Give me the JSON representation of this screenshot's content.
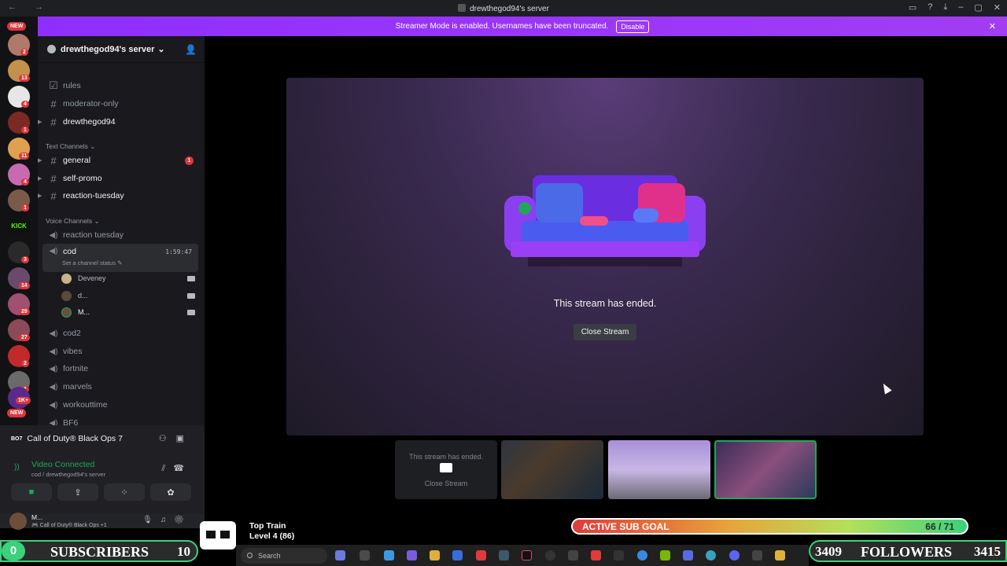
{
  "window": {
    "title": "drewthegod94's server",
    "nav_glyphs": "← →",
    "controls": [
      "▭",
      "?",
      "⤓",
      "–",
      "▢",
      "✕"
    ]
  },
  "banner": {
    "text": "Streamer Mode is enabled. Usernames have been truncated.",
    "disable_label": "Disable",
    "close_glyph": "✕"
  },
  "rail": {
    "new_top": "NEW",
    "new_bottom": "NEW",
    "badges": [
      "2",
      "13",
      "4",
      "1",
      "11",
      "4",
      "1",
      "3",
      "14",
      "29",
      "27",
      "2",
      "1",
      "1K+"
    ]
  },
  "server": {
    "name": "drewthegod94's server",
    "chevron": "⌄",
    "invite_glyph": "👤"
  },
  "channels_top": [
    {
      "name": "rules",
      "glyph": "☑"
    },
    {
      "name": "moderator-only",
      "glyph": "#"
    },
    {
      "name": "drewthegod94",
      "glyph": "#"
    }
  ],
  "text_category": "Text Channels",
  "text_channels": [
    {
      "name": "general",
      "unread": "1"
    },
    {
      "name": "self-promo"
    },
    {
      "name": "reaction-tuesday"
    }
  ],
  "voice_category": "Voice Channels",
  "voice_channels": {
    "reaction": "reaction tuesday",
    "active": {
      "name": "cod",
      "timer": "1:59:47",
      "status": "Set a channel status"
    },
    "members": [
      "Deveney",
      "d...",
      "M..."
    ],
    "rest": [
      "cod2",
      "vibes",
      "fortnite",
      "marvels",
      "workouttime",
      "BF6"
    ]
  },
  "voice_panel": {
    "game_logo": "BO7",
    "game": "Call of Duty® Black Ops 7",
    "connected": "Video Connected",
    "path": "cod / drewthegod94's server"
  },
  "user": {
    "name": "M...",
    "status": "🎮 Call of Duty® Black Ops +1"
  },
  "stage": {
    "ended_text": "This stream has ended.",
    "close_label": "Close Stream"
  },
  "thumbs": {
    "ended_text": "This stream has ended.",
    "close_label": "Close Stream"
  },
  "overlay": {
    "sub_goal_label": "ACTIVE SUB GOAL",
    "sub_goal_count": "66 / 71",
    "sub_goal_progress": 0.93,
    "subs_left": "0",
    "subs_label": "SUBSCRIBERS",
    "subs_right": "10",
    "followers_left": "3409",
    "followers_label": "FOLLOWERS",
    "followers_right": "3415",
    "train_title": "Top Train",
    "train_level": "Level 4  (86)"
  },
  "taskbar": {
    "search_placeholder": "Search"
  },
  "colors": {
    "banner": "#a23df2",
    "accent_green": "#23a55a",
    "unread_red": "#da373c"
  }
}
